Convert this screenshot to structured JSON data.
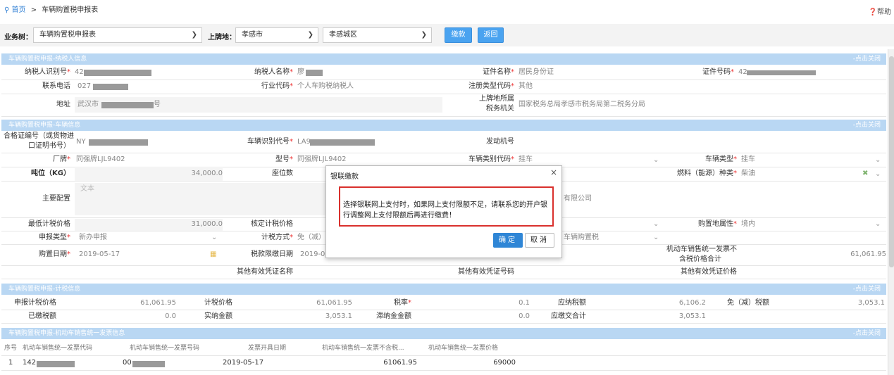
{
  "breadcrumb": {
    "home": "首页",
    "sep": ">",
    "current": "车辆购置税申报表"
  },
  "help": "帮助",
  "toolbar": {
    "business_tree_label": "业务树：",
    "business_tree_value": "车辆购置税申报表",
    "plate_label": "上牌地：",
    "city_value": "孝感市",
    "district_value": "孝感城区",
    "pay_button": "缴款",
    "back_button": "返回"
  },
  "sections": {
    "taxpayer": "车辆购置税申报-纳税人信息",
    "vehicle": "车辆购置税申报-车辆信息",
    "calc": "车辆购置税申报-计税信息",
    "invoice": "车辆购置税申报-机动车销售统一发票信息",
    "close_label": "-点击关闭"
  },
  "taxpayer": {
    "tax_id_label": "纳税人识别号",
    "tax_id_value": "42",
    "name_label": "纳税人名称",
    "name_value": "廖",
    "cert_name_label": "证件名称",
    "cert_name_value": "居民身份证",
    "cert_no_label": "证件号码",
    "cert_no_value": "42",
    "phone_label": "联系电话",
    "phone_value": "027",
    "industry_label": "行业代码",
    "industry_value": "个人车购税纳税人",
    "reg_type_label": "注册类型代码",
    "reg_type_value": "其他",
    "address_label": "地址",
    "address_value_a": "武汉市",
    "address_value_b": "号",
    "tax_office_label_1": "上牌地所属",
    "tax_office_label_2": "税务机关",
    "tax_office_value": "国家税务总局孝感市税务局第二税务分局"
  },
  "vehicle": {
    "cert_no_label_1": "合格证编号（或货物进",
    "cert_no_label_2": "口证明书号）",
    "cert_no_value": "NY",
    "vin_label": "车辆识别代号",
    "vin_value": "LA9",
    "engine_label": "发动机号",
    "maker_label": "厂牌",
    "maker_value": "同强牌LJL9402",
    "model_label": "型号",
    "model_value": "同强牌LJL9402",
    "category_label": "车辆类别代码",
    "category_value": "挂车",
    "type_label": "车辆类型",
    "type_value": "挂车",
    "tonnage_label": "吨位（KG）",
    "tonnage_value": "34,000.0",
    "seats_label": "座位数",
    "fuel_label": "燃料（能源）种类",
    "fuel_value": "柴油",
    "config_label": "主要配置",
    "config_placeholder": "文本",
    "company_suffix": "有限公司",
    "min_price_label": "最低计税价格",
    "min_price_value": "31,000.0",
    "approved_price_label": "核定计税价格",
    "purchase_attr_label": "购置地属性",
    "purchase_attr_value": "境内",
    "decl_type_label": "申报类型",
    "decl_type_value": "新办申报",
    "tax_method_label": "计税方式",
    "tax_method_value": "免（减）",
    "vehicle_tax_value": "车辆购置税",
    "purchase_date_label": "购置日期",
    "purchase_date_value": "2019-05-17",
    "deadline_label": "税款限缴日期",
    "deadline_value": "2019-07",
    "invoice_total_label_1": "机动车销售统一发票不",
    "invoice_total_label_2": "含税价格合计",
    "invoice_total_value": "61,061.95",
    "other_cert_name_label": "其他有效凭证名称",
    "other_cert_no_label": "其他有效凭证号码",
    "other_cert_price_label": "其他有效凭证价格"
  },
  "calc": {
    "decl_price_label": "申报计税价格",
    "decl_price_value": "61,061.95",
    "tax_price_label": "计税价格",
    "tax_price_value": "61,061.95",
    "rate_label": "税率",
    "rate_value": "0.1",
    "payable_label": "应纳税额",
    "payable_value": "6,106.2",
    "exempt_label": "免（减）税额",
    "exempt_value": "3,053.1",
    "paid_label": "已缴税额",
    "paid_value": "0.0",
    "actual_label": "实纳金额",
    "actual_value": "3,053.1",
    "late_fee_label": "滞纳金金额",
    "late_fee_value": "0.0",
    "total_due_label": "应缴交合计",
    "total_due_value": "3,053.1"
  },
  "invoice_table": {
    "headers": [
      "序号",
      "机动车销售统一发票代码",
      "机动车销售统一发票号码",
      "发票开具日期",
      "机动车销售统一发票不含税...",
      "机动车销售统一发票价格"
    ],
    "row": {
      "index": "1",
      "code": "142",
      "number": "00",
      "date": "2019-05-17",
      "price_ex_tax": "61061.95",
      "price": "69000"
    }
  },
  "modal": {
    "title": "银联缴款",
    "close": "×",
    "message": "选择银联网上支付时，如果网上支付限额不足，请联系您的开户银行调整网上支付限额后再进行缴费！",
    "ok": "确定",
    "cancel": "取消"
  },
  "colors": {
    "accent": "#4aa3f0",
    "section_header": "#b9d7f3",
    "alert_border": "#d9302c"
  }
}
